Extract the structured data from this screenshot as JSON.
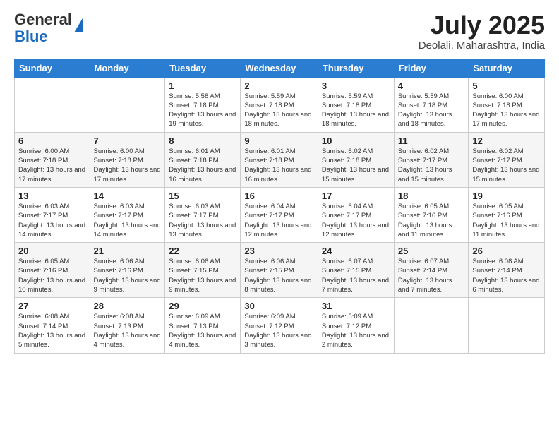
{
  "logo": {
    "general": "General",
    "blue": "Blue"
  },
  "header": {
    "month": "July 2025",
    "location": "Deolali, Maharashtra, India"
  },
  "days_of_week": [
    "Sunday",
    "Monday",
    "Tuesday",
    "Wednesday",
    "Thursday",
    "Friday",
    "Saturday"
  ],
  "weeks": [
    [
      {
        "day": "",
        "info": ""
      },
      {
        "day": "",
        "info": ""
      },
      {
        "day": "1",
        "info": "Sunrise: 5:58 AM\nSunset: 7:18 PM\nDaylight: 13 hours and 19 minutes."
      },
      {
        "day": "2",
        "info": "Sunrise: 5:59 AM\nSunset: 7:18 PM\nDaylight: 13 hours and 18 minutes."
      },
      {
        "day": "3",
        "info": "Sunrise: 5:59 AM\nSunset: 7:18 PM\nDaylight: 13 hours and 18 minutes."
      },
      {
        "day": "4",
        "info": "Sunrise: 5:59 AM\nSunset: 7:18 PM\nDaylight: 13 hours and 18 minutes."
      },
      {
        "day": "5",
        "info": "Sunrise: 6:00 AM\nSunset: 7:18 PM\nDaylight: 13 hours and 17 minutes."
      }
    ],
    [
      {
        "day": "6",
        "info": "Sunrise: 6:00 AM\nSunset: 7:18 PM\nDaylight: 13 hours and 17 minutes."
      },
      {
        "day": "7",
        "info": "Sunrise: 6:00 AM\nSunset: 7:18 PM\nDaylight: 13 hours and 17 minutes."
      },
      {
        "day": "8",
        "info": "Sunrise: 6:01 AM\nSunset: 7:18 PM\nDaylight: 13 hours and 16 minutes."
      },
      {
        "day": "9",
        "info": "Sunrise: 6:01 AM\nSunset: 7:18 PM\nDaylight: 13 hours and 16 minutes."
      },
      {
        "day": "10",
        "info": "Sunrise: 6:02 AM\nSunset: 7:18 PM\nDaylight: 13 hours and 15 minutes."
      },
      {
        "day": "11",
        "info": "Sunrise: 6:02 AM\nSunset: 7:17 PM\nDaylight: 13 hours and 15 minutes."
      },
      {
        "day": "12",
        "info": "Sunrise: 6:02 AM\nSunset: 7:17 PM\nDaylight: 13 hours and 15 minutes."
      }
    ],
    [
      {
        "day": "13",
        "info": "Sunrise: 6:03 AM\nSunset: 7:17 PM\nDaylight: 13 hours and 14 minutes."
      },
      {
        "day": "14",
        "info": "Sunrise: 6:03 AM\nSunset: 7:17 PM\nDaylight: 13 hours and 14 minutes."
      },
      {
        "day": "15",
        "info": "Sunrise: 6:03 AM\nSunset: 7:17 PM\nDaylight: 13 hours and 13 minutes."
      },
      {
        "day": "16",
        "info": "Sunrise: 6:04 AM\nSunset: 7:17 PM\nDaylight: 13 hours and 12 minutes."
      },
      {
        "day": "17",
        "info": "Sunrise: 6:04 AM\nSunset: 7:17 PM\nDaylight: 13 hours and 12 minutes."
      },
      {
        "day": "18",
        "info": "Sunrise: 6:05 AM\nSunset: 7:16 PM\nDaylight: 13 hours and 11 minutes."
      },
      {
        "day": "19",
        "info": "Sunrise: 6:05 AM\nSunset: 7:16 PM\nDaylight: 13 hours and 11 minutes."
      }
    ],
    [
      {
        "day": "20",
        "info": "Sunrise: 6:05 AM\nSunset: 7:16 PM\nDaylight: 13 hours and 10 minutes."
      },
      {
        "day": "21",
        "info": "Sunrise: 6:06 AM\nSunset: 7:16 PM\nDaylight: 13 hours and 9 minutes."
      },
      {
        "day": "22",
        "info": "Sunrise: 6:06 AM\nSunset: 7:15 PM\nDaylight: 13 hours and 9 minutes."
      },
      {
        "day": "23",
        "info": "Sunrise: 6:06 AM\nSunset: 7:15 PM\nDaylight: 13 hours and 8 minutes."
      },
      {
        "day": "24",
        "info": "Sunrise: 6:07 AM\nSunset: 7:15 PM\nDaylight: 13 hours and 7 minutes."
      },
      {
        "day": "25",
        "info": "Sunrise: 6:07 AM\nSunset: 7:14 PM\nDaylight: 13 hours and 7 minutes."
      },
      {
        "day": "26",
        "info": "Sunrise: 6:08 AM\nSunset: 7:14 PM\nDaylight: 13 hours and 6 minutes."
      }
    ],
    [
      {
        "day": "27",
        "info": "Sunrise: 6:08 AM\nSunset: 7:14 PM\nDaylight: 13 hours and 5 minutes."
      },
      {
        "day": "28",
        "info": "Sunrise: 6:08 AM\nSunset: 7:13 PM\nDaylight: 13 hours and 4 minutes."
      },
      {
        "day": "29",
        "info": "Sunrise: 6:09 AM\nSunset: 7:13 PM\nDaylight: 13 hours and 4 minutes."
      },
      {
        "day": "30",
        "info": "Sunrise: 6:09 AM\nSunset: 7:12 PM\nDaylight: 13 hours and 3 minutes."
      },
      {
        "day": "31",
        "info": "Sunrise: 6:09 AM\nSunset: 7:12 PM\nDaylight: 13 hours and 2 minutes."
      },
      {
        "day": "",
        "info": ""
      },
      {
        "day": "",
        "info": ""
      }
    ]
  ]
}
